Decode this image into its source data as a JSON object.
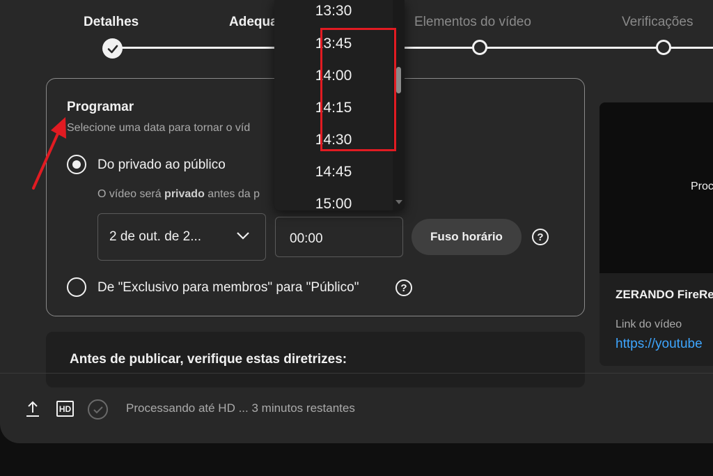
{
  "stepper": {
    "steps": [
      {
        "label": "Detalhes",
        "state": "done"
      },
      {
        "label": "Adequa",
        "state": "current"
      },
      {
        "label": "Elementos do vídeo",
        "state": "pending"
      },
      {
        "label": "Verificações",
        "state": "pending"
      }
    ]
  },
  "schedule": {
    "title": "Programar",
    "subtitle": "Selecione uma data para tornar o víd",
    "option_private_to_public": "Do privado ao público",
    "hint_prefix": "O vídeo será ",
    "hint_bold": "privado",
    "hint_suffix": " antes da p",
    "date_value": "2 de out. de 2...",
    "time_value": "00:00",
    "timezone_button": "Fuso horário",
    "help_symbol": "?",
    "option_members_to_public": "De \"Exclusivo para membros\" para \"Público\""
  },
  "guidelines": {
    "title": "Antes de publicar, verifique estas diretrizes:"
  },
  "preview": {
    "processing_text": "Proc",
    "video_title": "ZERANDO FireRe",
    "link_label": "Link do vídeo",
    "link_value": "https://youtube"
  },
  "footer": {
    "hd_label": "HD",
    "status_text": "Processando até HD ... 3 minutos restantes"
  },
  "time_dropdown": {
    "options": [
      "13:30",
      "13:45",
      "14:00",
      "14:15",
      "14:30",
      "14:45",
      "15:00"
    ],
    "highlighted": [
      "13:45",
      "14:00",
      "14:15",
      "14:30"
    ]
  },
  "colors": {
    "background": "#282828",
    "text": "#f1f1f1",
    "muted": "#aaaaaa",
    "link": "#3ea6ff",
    "highlight": "#e11b22"
  },
  "icons": [
    "check-icon",
    "chevron-down-icon",
    "help-icon",
    "upload-icon",
    "hd-icon",
    "check-circle-icon",
    "red-arrow-icon"
  ]
}
